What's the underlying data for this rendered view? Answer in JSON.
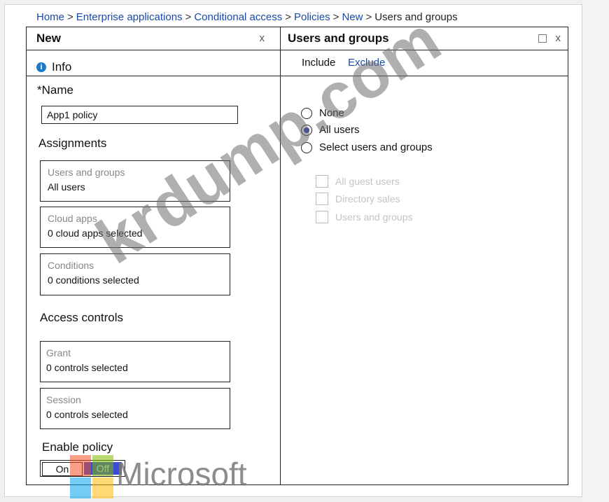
{
  "breadcrumb": {
    "items": [
      "Home",
      "Enterprise applications",
      "Conditional access",
      "Policies",
      "New"
    ],
    "current": "Users and groups",
    "separator": ">"
  },
  "new_blade": {
    "title": "New",
    "close": "x",
    "info": "Info",
    "name_label": "*Name",
    "name_value": "App1 policy",
    "assignments_label": "Assignments",
    "cards": {
      "users": {
        "title": "Users and groups",
        "value": "All users"
      },
      "cloud_apps": {
        "title": "Cloud apps",
        "value": "0 cloud apps selected"
      },
      "conditions": {
        "title": "Conditions",
        "value": "0 conditions selected"
      },
      "grant": {
        "title": "Grant",
        "value": "0 controls selected"
      },
      "session": {
        "title": "Session",
        "value": "0 controls selected"
      }
    },
    "access_controls_label": "Access controls",
    "enable_policy_label": "Enable policy",
    "toggle": {
      "on": "On",
      "off": "Off",
      "selected": "Off"
    }
  },
  "users_blade": {
    "title": "Users and groups",
    "close": "x",
    "tabs": {
      "include": "Include",
      "exclude": "Exclude"
    },
    "radios": [
      {
        "label": "None",
        "checked": false
      },
      {
        "label": "All users",
        "checked": true
      },
      {
        "label": "Select users and groups",
        "checked": false
      }
    ],
    "checkboxes": [
      {
        "label": "All guest users"
      },
      {
        "label": "Directory sales"
      },
      {
        "label": "Users and groups"
      }
    ]
  },
  "watermark": {
    "text": "krdump.com",
    "brand": "Microsoft"
  },
  "colors": {
    "link": "#1a4aa8",
    "radio_dot": "#1b2fbf",
    "toggle_off": "#3a4bd6",
    "info_icon": "#1b79c8"
  }
}
